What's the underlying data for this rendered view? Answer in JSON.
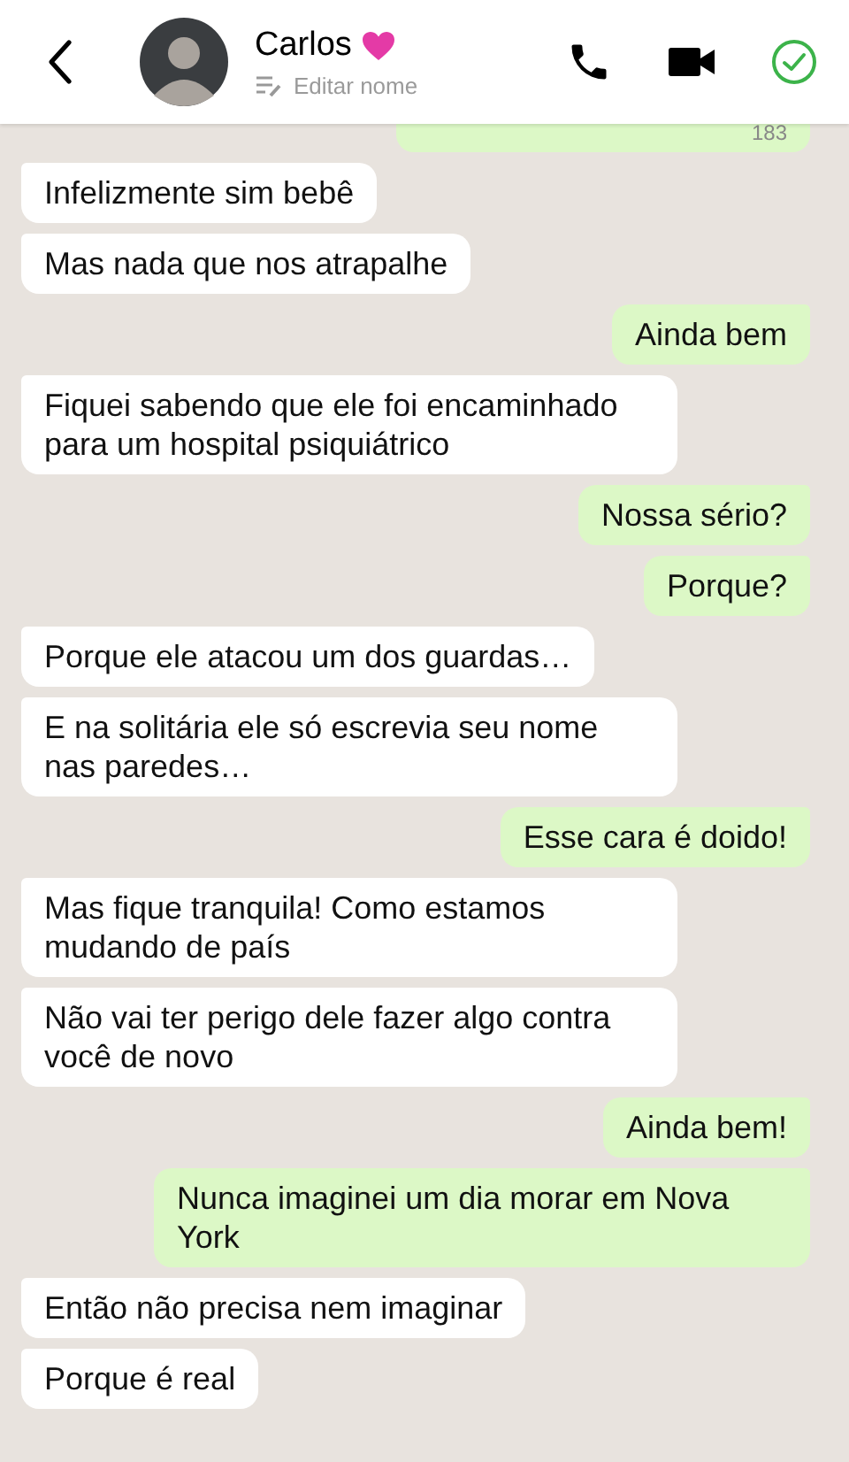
{
  "header": {
    "contact_name": "Carlos",
    "edit_label": "Editar nome"
  },
  "messages": [
    {
      "kind": "out",
      "meta": "183"
    },
    {
      "kind": "in",
      "text": "Infelizmente sim bebê"
    },
    {
      "kind": "in",
      "text": "Mas nada que nos atrapalhe"
    },
    {
      "kind": "out",
      "text": "Ainda bem"
    },
    {
      "kind": "in",
      "text": "Fiquei sabendo que ele foi encaminhado para um hospital psiquiátrico"
    },
    {
      "kind": "out",
      "text": "Nossa sério?"
    },
    {
      "kind": "out",
      "text": "Porque?"
    },
    {
      "kind": "in",
      "text": "Porque ele atacou um dos guardas…"
    },
    {
      "kind": "in",
      "text": "E na solitária ele só escrevia seu nome nas paredes…"
    },
    {
      "kind": "out",
      "text": "Esse cara é doido!"
    },
    {
      "kind": "in",
      "text": "Mas fique tranquila! Como estamos mudando de país"
    },
    {
      "kind": "in",
      "text": "Não vai ter perigo dele fazer algo contra você de novo"
    },
    {
      "kind": "out",
      "text": "Ainda bem!"
    },
    {
      "kind": "out",
      "text": "Nunca imaginei um dia morar em Nova York"
    },
    {
      "kind": "in",
      "text": "Então não precisa nem imaginar"
    },
    {
      "kind": "in",
      "text": "Porque é real"
    }
  ]
}
